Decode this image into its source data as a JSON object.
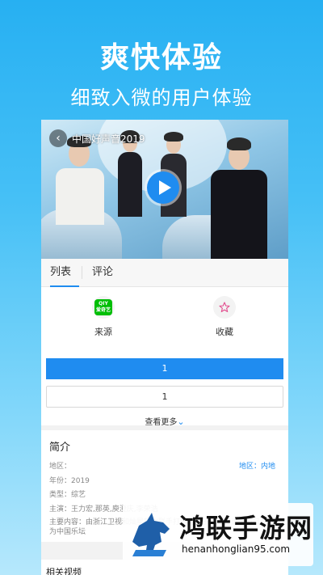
{
  "promo": {
    "title": "爽快体验",
    "subtitle": "细致入微的用户体验"
  },
  "video": {
    "title": "中国好声音2019",
    "back_icon": "chevron-left-icon",
    "play_icon": "play-icon"
  },
  "tabs": [
    {
      "label": "列表",
      "active": true
    },
    {
      "label": "评论",
      "active": false
    }
  ],
  "actions": {
    "source": {
      "label": "来源",
      "icon_text": "爱奇艺"
    },
    "favorite": {
      "label": "收藏",
      "icon": "star-icon"
    }
  },
  "episodes": [
    {
      "label": "1",
      "selected": true
    },
    {
      "label": "1",
      "selected": false
    }
  ],
  "see_more": {
    "label": "查看更多",
    "icon": "chevron-down-icon"
  },
  "intro": {
    "title": "简介",
    "region_label": "地区：",
    "region_value": "地区：内地",
    "year": "年份：2019",
    "type": "类型：综艺",
    "cast": "主演：王力宏,那英,庾澄庆,李荣浩",
    "description": "主要内容：由浙江卫视和灿星制作联手打造的音乐励志评论类节目，旨在为中国乐坛"
  },
  "related": {
    "title": "相关视频"
  },
  "watermark": {
    "main": "鸿联手游网",
    "url": "henanhonglian95.com"
  },
  "colors": {
    "accent": "#1f8cf0",
    "background_top": "#27b0f2",
    "iqiyi_green": "#00be06"
  }
}
